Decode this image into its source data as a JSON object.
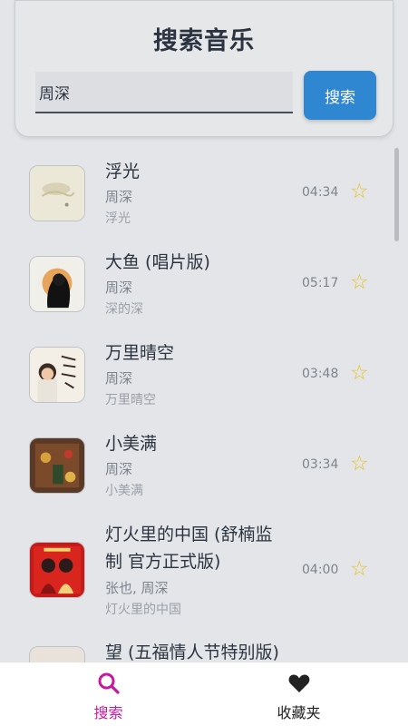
{
  "header": {
    "title": "搜索音乐",
    "search_value": "周深",
    "search_button_label": "搜索"
  },
  "songs": [
    {
      "title": "浮光",
      "artist": "周深",
      "album": "浮光",
      "duration": "04:34",
      "favorite_icon": "star-outline-icon"
    },
    {
      "title": "大鱼 (唱片版)",
      "artist": "周深",
      "album": "深的深",
      "duration": "05:17",
      "favorite_icon": "star-outline-icon"
    },
    {
      "title": "万里晴空",
      "artist": "周深",
      "album": "万里晴空",
      "duration": "03:48",
      "favorite_icon": "star-outline-icon"
    },
    {
      "title": "小美满",
      "artist": "周深",
      "album": "小美满",
      "duration": "03:34",
      "favorite_icon": "star-outline-icon"
    },
    {
      "title_line1": "灯火里的中国 (舒楠监",
      "title_line2": "制 官方正式版)",
      "artist": "张也, 周深",
      "album": "灯火里的中国",
      "duration": "04:00",
      "favorite_icon": "star-outline-icon"
    },
    {
      "title": "望 (五福情人节特别版)"
    }
  ],
  "bottom_nav": {
    "search_label": "搜索",
    "favorites_label": "收藏夹",
    "active_color": "#c8189f",
    "inactive_color": "#222222"
  },
  "colors": {
    "accent": "#2f86d1",
    "star": "#e8c21d"
  }
}
